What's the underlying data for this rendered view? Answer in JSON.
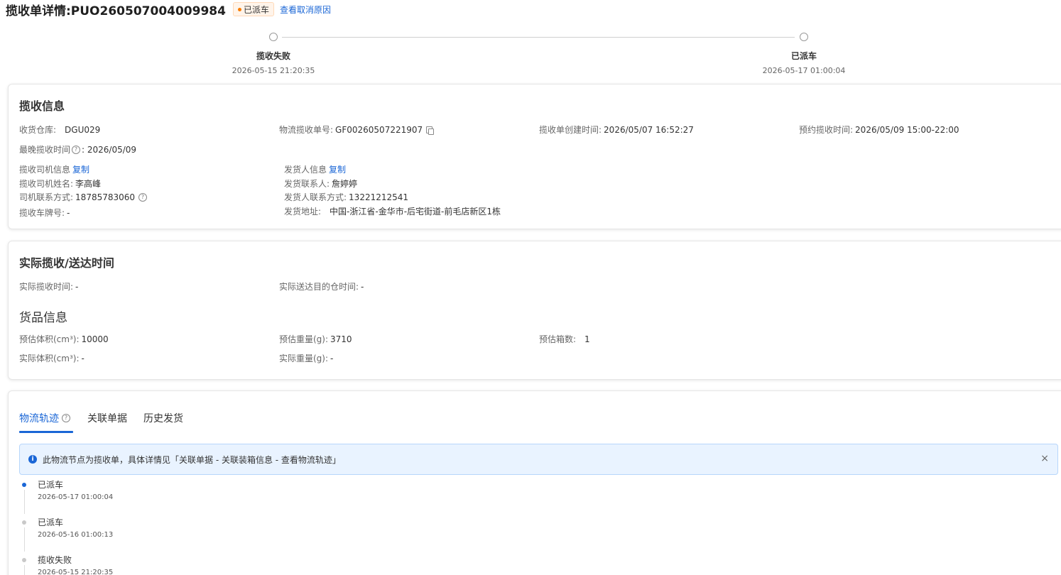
{
  "header": {
    "title": "揽收单详情:PUO260507004009984",
    "status_badge": "已派车",
    "cancel_reason_link": "查看取消原因"
  },
  "steps": [
    {
      "label": "揽收失败",
      "time": "2026-05-15 21:20:35"
    },
    {
      "label": "已派车",
      "time": "2026-05-17 01:00:04"
    }
  ],
  "pickup_info": {
    "title": "揽收信息",
    "warehouse_label": "收货仓库:",
    "warehouse_value": "DGU029",
    "tracking_label": "物流揽收单号:",
    "tracking_value": "GF00260507221907",
    "created_label": "揽收单创建时间:",
    "created_value": "2026/05/07 16:52:27",
    "reserved_label": "预约揽收时间:",
    "reserved_value": "2026/05/09 15:00-22:00",
    "latest_label": "最晚揽收时间",
    "latest_value": ": 2026/05/09",
    "driver_info_label": "揽收司机信息",
    "driver_copy": "复制",
    "driver_name_label": "揽收司机姓名:",
    "driver_name_value": "李高峰",
    "driver_phone_label": "司机联系方式:",
    "driver_phone_value": "18785783060",
    "plate_label": "揽收车牌号:",
    "plate_value": "-",
    "shipper_info_label": "发货人信息",
    "shipper_copy": "复制",
    "shipper_contact_label": "发货联系人:",
    "shipper_contact_value": "詹婷婷",
    "shipper_phone_label": "发货人联系方式:",
    "shipper_phone_value": "13221212541",
    "shipper_addr_label": "发货地址:",
    "shipper_addr_value": "中国-浙江省-金华市-后宅街道-前毛店新区1栋"
  },
  "actual_time": {
    "title": "实际揽收/送达时间",
    "pickup_label": "实际揽收时间:",
    "pickup_value": "-",
    "arrival_label": "实际送达目的仓时间:",
    "arrival_value": "-"
  },
  "goods": {
    "title": "货品信息",
    "est_volume_label": "预估体积(cm³):",
    "est_volume_value": "10000",
    "est_weight_label": "预估重量(g):",
    "est_weight_value": "3710",
    "est_boxes_label": "预估箱数:",
    "est_boxes_value": "1",
    "act_volume_label": "实际体积(cm³):",
    "act_volume_value": "-",
    "act_weight_label": "实际重量(g):",
    "act_weight_value": "-"
  },
  "tabs": [
    {
      "label": "物流轨迹"
    },
    {
      "label": "关联单据"
    },
    {
      "label": "历史发货"
    }
  ],
  "notice": {
    "text": "此物流节点为揽收单，具体详情见「关联单据 - 关联装箱信息 - 查看物流轨迹」",
    "close": "×"
  },
  "timeline": [
    {
      "title": "已派车",
      "time": "2026-05-17 01:00:04"
    },
    {
      "title": "已派车",
      "time": "2026-05-16 01:00:13"
    },
    {
      "title": "揽收失败",
      "time": "2026-05-15 21:20:35"
    }
  ],
  "colors": {
    "accent": "#1a66d6",
    "badge_dot": "#fa7d00"
  },
  "icons": {
    "help": "question-circle-icon",
    "copy": "copy-icon",
    "info": "info-circle-icon",
    "close": "close-icon"
  }
}
